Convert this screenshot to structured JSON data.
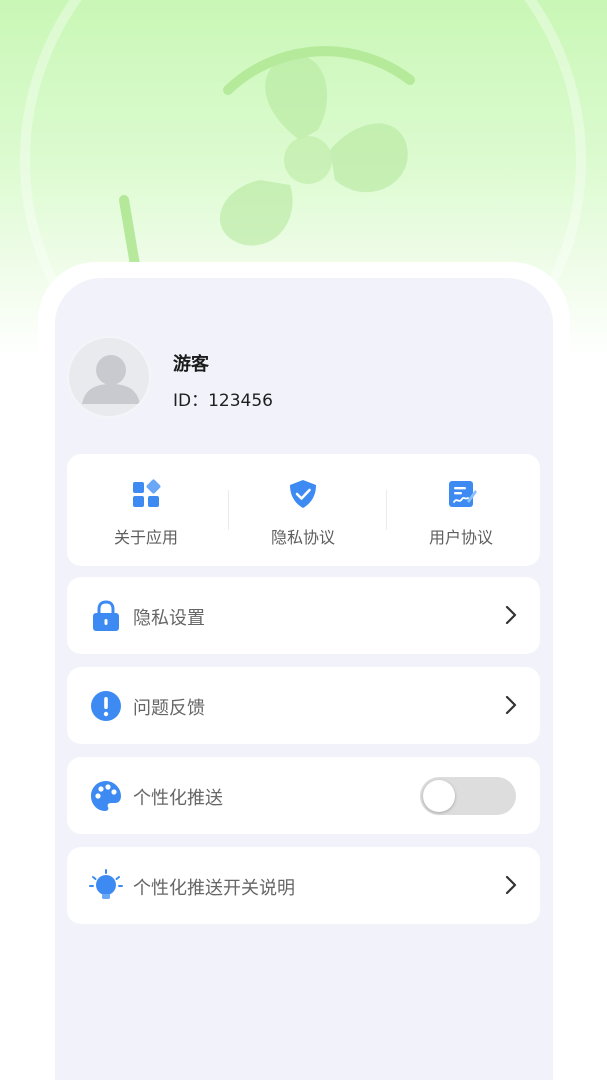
{
  "profile": {
    "name": "游客",
    "id_label": "ID：123456"
  },
  "quick_actions": [
    {
      "label": "关于应用",
      "icon": "grid-apps-icon"
    },
    {
      "label": "隐私协议",
      "icon": "shield-check-icon"
    },
    {
      "label": "用户协议",
      "icon": "document-edit-icon"
    }
  ],
  "menu": {
    "privacy_settings": {
      "label": "隐私设置",
      "icon": "lock-icon"
    },
    "feedback": {
      "label": "问题反馈",
      "icon": "exclamation-icon"
    },
    "personalized_push": {
      "label": "个性化推送",
      "icon": "palette-icon",
      "enabled": false
    },
    "push_explanation": {
      "label": "个性化推送开关说明",
      "icon": "lightbulb-icon"
    }
  },
  "colors": {
    "accent_blue": "#3d8bf2",
    "header_green": "#c9f7b6",
    "toggle_off": "#dddddd"
  }
}
